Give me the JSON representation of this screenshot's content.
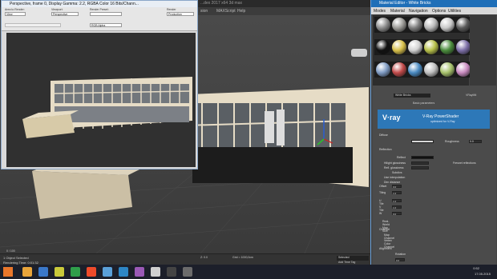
{
  "app": {
    "title_fragment": "...dex  2017 x64     3d max",
    "menu": [
      "sion",
      "MAXScript",
      "Help"
    ]
  },
  "render_window": {
    "title": "Perspective, frame 0, Display Gamma: 2.2, RGBA Color 16 Bits/Chann...",
    "area_label": "Area to Render:",
    "area_value": "View",
    "viewport_label": "Viewport:",
    "viewport_value": "Perspective",
    "preset_label": "Render Preset:",
    "preset_value": "",
    "renderer_label": "Render",
    "renderer_value": "Production",
    "channel_value": "RGB Alpha"
  },
  "material_editor": {
    "title": "Material Editor - White Bricks",
    "menu": [
      "Modes",
      "Material",
      "Navigation",
      "Options",
      "Utilities"
    ],
    "material_name": "White Bricks",
    "material_type": "VRayMtl",
    "rollout_basic": "Basic parameters",
    "vray_logo": "V·ray",
    "vray_product": "V-Ray PowerShader",
    "vray_sub": "optimized for V-Ray",
    "diffuse_label": "Diffuse",
    "roughness_label": "Roughness",
    "roughness_value": "0.0",
    "reflection_label": "Reflection",
    "reflect_label": "Reflect",
    "hilight_gloss_label": "Hilight glossiness",
    "refl_gloss_label": "Refl. glossiness",
    "fresnel_label": "Fresnel reflections",
    "subdivs_label": "Subdivs",
    "use_interp_label": "Use interpolation",
    "dim_distance_label": "Dim distance",
    "tiling": [
      {
        "label": "Offset",
        "value": "0.0"
      },
      {
        "label": "Tiling",
        "value": "1.0"
      },
      {
        "label": "U Tile",
        "value": "1.0"
      },
      {
        "label": "V Tile",
        "value": "1.0"
      },
      {
        "label": "W",
        "value": "0.0"
      }
    ],
    "realworld_label": "Real-World Map Size",
    "channel_label": "Channel",
    "map_channel_label": "Map Channel",
    "vertex_channel_label": "Vertex Color Channel",
    "alignment_label": "Alignment",
    "rotation_label": "Rotation",
    "rotation_value": "0.0"
  },
  "status": {
    "selected": "1 Object Selected",
    "rendering_time": "Rendering Time: 0:01:32",
    "selected_dropdown": "Selected",
    "add_time_tag": "Add Time Tag",
    "coordinates": "Z: 0.0",
    "grid": "Grid = 1000,0cm",
    "frame_counter": "0 / 100"
  },
  "taskbar": {
    "time": "0:52",
    "date": "17.05.2015"
  },
  "slot_colors": [
    "#8c8c8c",
    "#9c9b97",
    "#7d7d7d",
    "#b9b9b9",
    "#c9c9c9",
    "#5a5a5a",
    "#111111",
    "#d8c04a",
    "#d2d2d2",
    "#b8c14a",
    "#4b8d3d",
    "#7d6fa8",
    "#7f9bc3",
    "#c14a4a",
    "#4a8ac1",
    "#bfbfbf",
    "#a7c26c",
    "#c98bc0"
  ]
}
